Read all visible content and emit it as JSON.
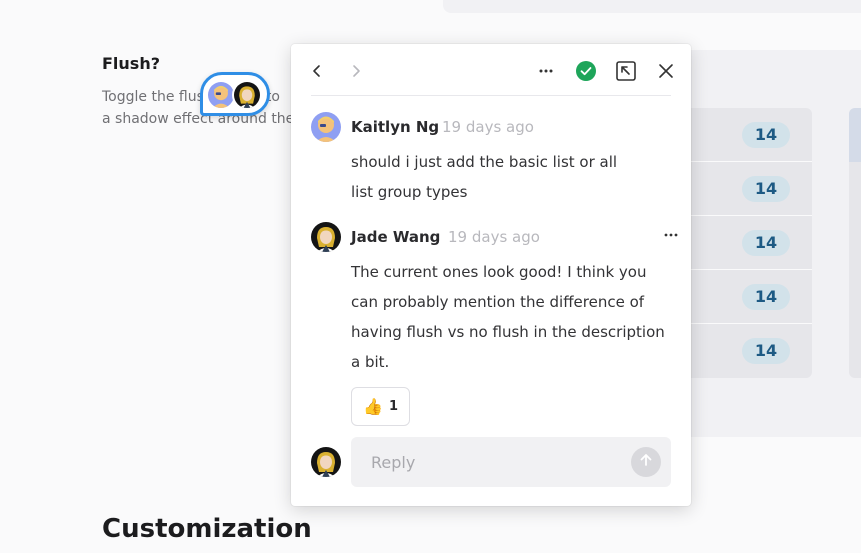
{
  "page": {
    "section_title": "Flush?",
    "section_description_lines": [
      "Toggle the flush option to",
      "a shadow effect around the"
    ],
    "heading": "Customization"
  },
  "list_preview": {
    "counts": [
      "14",
      "14",
      "14",
      "14",
      "14"
    ]
  },
  "colors": {
    "accent_blue": "#2f8ee6",
    "resolved_green": "#1ea55a",
    "badge_bg": "#d2e2ea",
    "badge_text": "#1d5a84"
  },
  "popup": {
    "toolbar": {
      "prev_icon": "chevron-left-icon",
      "next_icon": "chevron-right-icon",
      "more_icon": "more-horizontal-icon",
      "resolve_icon": "check-circle-icon",
      "expand_icon": "expand-icon",
      "close_icon": "close-icon"
    },
    "comments": [
      {
        "author": "Kaitlyn Ng",
        "time": "19 days ago",
        "body_lines": [
          "should i just add the basic list or all",
          "list group types"
        ]
      },
      {
        "author": "Jade Wang",
        "time": "19 days ago",
        "body_lines": [
          "The current ones look good! I think you",
          "can probably mention the difference of",
          "having flush vs no flush in the description",
          "a bit."
        ],
        "reaction": {
          "emoji": "👍",
          "count": "1"
        }
      }
    ],
    "reply": {
      "placeholder": "Reply"
    }
  }
}
